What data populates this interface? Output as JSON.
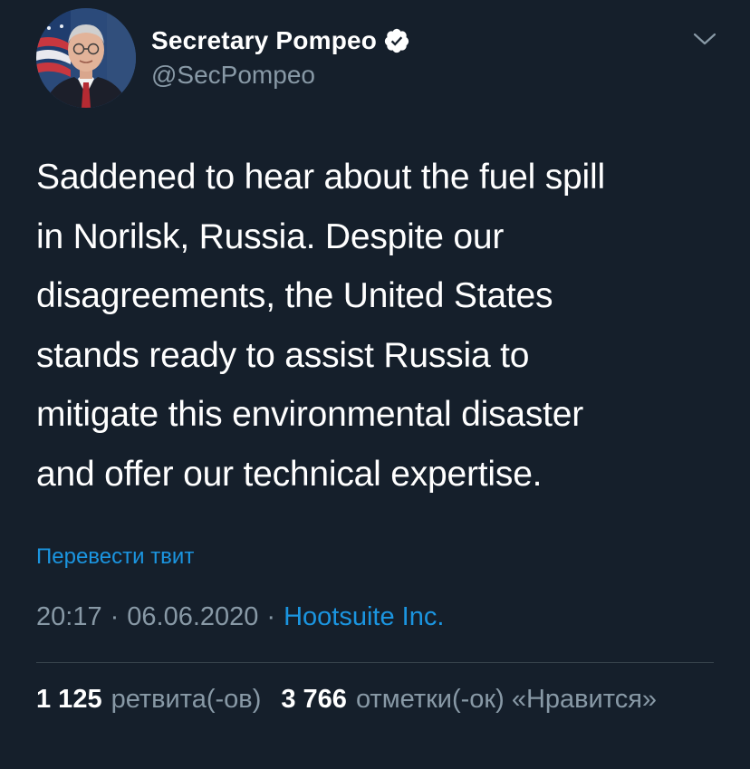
{
  "author": {
    "name": "Secretary Pompeo",
    "handle": "@SecPompeo",
    "verified": true
  },
  "tweet": {
    "text": "Saddened to hear about the fuel spill\nin Norilsk, Russia. Despite our\ndisagreements, the United States\nstands ready to assist Russia to\nmitigate this environmental disaster\nand offer our technical expertise.",
    "translate_label": "Перевести твит",
    "time": "20:17",
    "separator": "·",
    "date": "06.06.2020",
    "source": "Hootsuite Inc."
  },
  "stats": {
    "retweets_count": "1 125",
    "retweets_label": "ретвита(-ов)",
    "likes_count": "3 766",
    "likes_label": "отметки(-ок) «Нравится»"
  },
  "icons": {
    "verified": "verified-badge-icon",
    "menu": "chevron-down-icon"
  },
  "colors": {
    "background": "#151f2b",
    "link": "#1b95e0",
    "secondary_text": "#8899a6",
    "divider": "#38444d"
  }
}
